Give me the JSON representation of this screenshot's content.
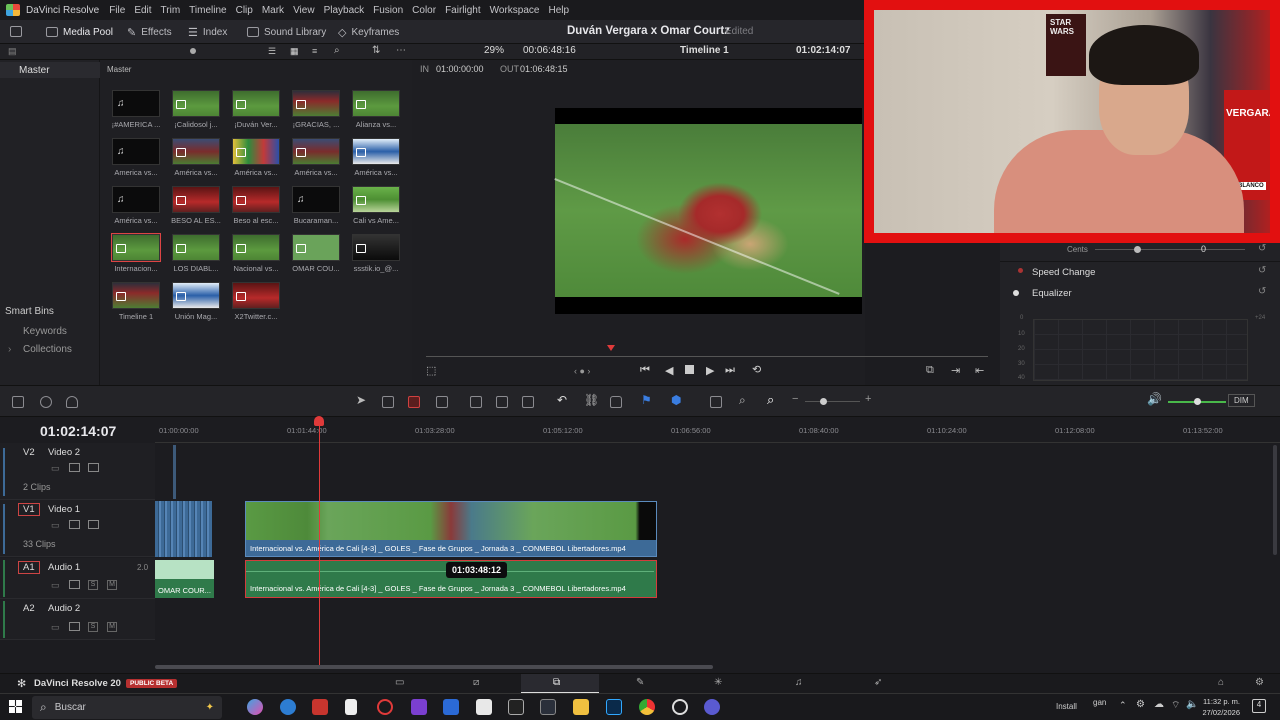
{
  "menubar": {
    "app_name": "DaVinci Resolve",
    "items": [
      "File",
      "Edit",
      "Trim",
      "Timeline",
      "Clip",
      "Mark",
      "View",
      "Playback",
      "Fusion",
      "Color",
      "Fairlight",
      "Workspace",
      "Help"
    ]
  },
  "toolbar": {
    "media_pool": "Media Pool",
    "effects": "Effects",
    "index": "Index",
    "sound_library": "Sound Library",
    "keyframes": "Keyframes",
    "project_title": "Duván Vergara x Omar Courtz",
    "status": "Edited"
  },
  "viewer": {
    "zoom": "29%",
    "duration": "00:06:48:16",
    "timeline_name": "Timeline 1",
    "timecode": "01:02:14:07",
    "in_label": "IN",
    "in_tc": "01:00:00:00",
    "out_label": "OUT",
    "out_tc": "01:06:48:15"
  },
  "bins": {
    "master": "Master",
    "pool_header": "Master",
    "smart_bins": "Smart Bins",
    "keywords": "Keywords",
    "collections": "Collections"
  },
  "pool": {
    "clips": [
      {
        "name": "¡#AMERICA ...",
        "style": "black"
      },
      {
        "name": "¡Calidosol j...",
        "style": "field"
      },
      {
        "name": "¡Duván Ver...",
        "style": "field"
      },
      {
        "name": "¡GRACIAS, ...",
        "style": "fieldred"
      },
      {
        "name": "Alianza vs...",
        "style": "field"
      },
      {
        "name": "America vs...",
        "style": "black"
      },
      {
        "name": "América vs...",
        "style": "crowd"
      },
      {
        "name": "América vs...",
        "style": "colorful"
      },
      {
        "name": "América vs...",
        "style": "crowd"
      },
      {
        "name": "América vs...",
        "style": "logo"
      },
      {
        "name": "América vs...",
        "style": "black"
      },
      {
        "name": "BESO AL ES...",
        "style": "reds"
      },
      {
        "name": "Beso al esc...",
        "style": "reds"
      },
      {
        "name": "Bucaraman...",
        "style": "black"
      },
      {
        "name": "Cali vs Ame...",
        "style": "bright"
      },
      {
        "name": "Internacion...",
        "style": "field"
      },
      {
        "name": "LOS DIABL...",
        "style": "field"
      },
      {
        "name": "Nacional vs...",
        "style": "field"
      },
      {
        "name": "OMAR COU...",
        "style": "plain"
      },
      {
        "name": "ssstik.io_@...",
        "style": "dark"
      },
      {
        "name": "Timeline 1",
        "style": "fieldred"
      },
      {
        "name": "Unión Mag...",
        "style": "logo"
      },
      {
        "name": "X2Twitter.c...",
        "style": "reds"
      }
    ]
  },
  "webcam": {
    "poster_text": "STAR WARS",
    "jersey_text": "VERGARA",
    "jersey_sub": "BLANCO"
  },
  "inspector": {
    "cents_label": "Cents",
    "cents_value": "0",
    "speed_change": "Speed Change",
    "equalizer": "Equalizer",
    "eq_labels": [
      "+24",
      "0",
      "10",
      "20",
      "30",
      "40"
    ]
  },
  "timeline": {
    "timecode": "01:02:14:07",
    "dim": "DIM",
    "ruler": [
      "01:00:00:00",
      "01:01:44:00",
      "01:03:28:00",
      "01:05:12:00",
      "01:06:56:00",
      "01:08:40:00",
      "01:10:24:00",
      "01:12:08:00",
      "01:13:52:00"
    ],
    "tracks": {
      "v2": {
        "id": "V2",
        "name": "Video 2",
        "clips": "2 Clips"
      },
      "v1": {
        "id": "V1",
        "name": "Video 1",
        "clips": "33 Clips"
      },
      "a1": {
        "id": "A1",
        "name": "Audio 1",
        "level": "2.0"
      },
      "a2": {
        "id": "A2",
        "name": "Audio 2"
      }
    },
    "video_clip": "Internacional vs. América de Cali [4-3] _ GOLES _ Fase de Grupos _ Jornada 3 _ CONMEBOL Libertadores.mp4",
    "audio_clip": "Internacional vs. América de Cali [4-3] _ GOLES _ Fase de Grupos _ Jornada 3 _ CONMEBOL Libertadores.mp4",
    "omar_clip": "OMAR COUR...",
    "tooltip": "01:03:48:12",
    "solo": "S",
    "mute": "M"
  },
  "pagebar": {
    "brand": "DaVinci Resolve 20",
    "beta": "PUBLIC BETA"
  },
  "taskbar": {
    "search": "Buscar",
    "install": "Install",
    "gan": "gan",
    "time": "11:32 p. m.",
    "date": "27/02/2026",
    "notifications": "4"
  }
}
